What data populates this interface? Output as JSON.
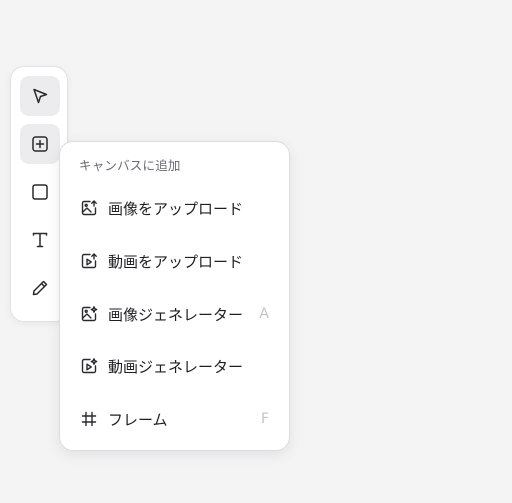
{
  "toolbar": {
    "tools": [
      {
        "name": "select",
        "icon": "cursor-arrow-icon",
        "active": true
      },
      {
        "name": "add",
        "icon": "plus-square-icon",
        "active": true
      },
      {
        "name": "rectangle",
        "icon": "square-icon",
        "active": false
      },
      {
        "name": "text",
        "icon": "text-icon",
        "active": false
      },
      {
        "name": "draw",
        "icon": "pencil-icon",
        "active": false
      }
    ]
  },
  "menu": {
    "header": "キャンバスに追加",
    "items": [
      {
        "label": "画像をアップロード",
        "icon": "image-upload-icon",
        "shortcut": ""
      },
      {
        "label": "動画をアップロード",
        "icon": "video-upload-icon",
        "shortcut": ""
      },
      {
        "label": "画像ジェネレーター",
        "icon": "image-generate-icon",
        "shortcut": "A"
      },
      {
        "label": "動画ジェネレーター",
        "icon": "video-generate-icon",
        "shortcut": ""
      },
      {
        "label": "フレーム",
        "icon": "frame-hash-icon",
        "shortcut": "F"
      }
    ]
  }
}
